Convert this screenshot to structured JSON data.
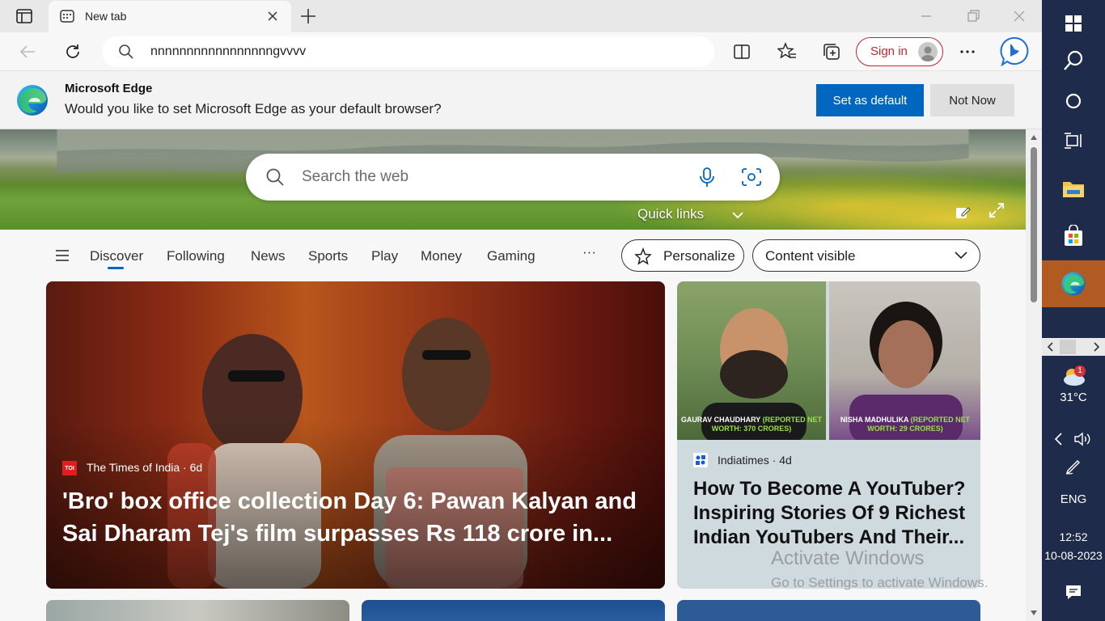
{
  "tab": {
    "title": "New tab"
  },
  "address_bar": {
    "value": "nnnnnnnnnnnnnnnnngvvvv"
  },
  "toolbar": {
    "sign_in_label": "Sign in"
  },
  "infobar": {
    "title": "Microsoft Edge",
    "message": "Would you like to set Microsoft Edge as your default browser?",
    "primary_button": "Set as default",
    "secondary_button": "Not Now"
  },
  "hero": {
    "search_placeholder": "Search the web",
    "quick_links_label": "Quick links"
  },
  "feed_nav": {
    "items": [
      "Discover",
      "Following",
      "News",
      "Sports",
      "Play",
      "Money",
      "Gaming"
    ],
    "more_label": "···",
    "active": "Discover",
    "personalize_label": "Personalize",
    "visibility_label": "Content visible"
  },
  "cards": {
    "main": {
      "source": "The Times of India · 6d",
      "source_logo_text": "TOI",
      "headline": "'Bro' box office collection Day 6: Pawan Kalyan and Sai Dharam Tej's film surpasses Rs 118 crore in..."
    },
    "side": {
      "caption_left_name": "GAURAV CHAUDHARY",
      "caption_left_note": "(REPORTED NET WORTH: 370 CRORES)",
      "caption_right_name": "NISHA MADHULIKA",
      "caption_right_note": "(REPORTED NET WORTH: 29 CRORES)",
      "source": "Indiatimes · 4d",
      "headline": "How To Become A YouTuber? Inspiring Stories Of 9 Richest Indian YouTubers And Their..."
    }
  },
  "watermark": {
    "line1": "Activate Windows",
    "line2": "Go to Settings to activate Windows."
  },
  "taskbar": {
    "weather_badge": "1",
    "temperature": "31°C",
    "language": "ENG",
    "time": "12:52",
    "date": "10-08-2023"
  },
  "colors": {
    "accent": "#0067c0",
    "sign_in_red": "#c4262e",
    "taskbar": "#1f2b4a",
    "taskbar_active": "#b15a22"
  }
}
